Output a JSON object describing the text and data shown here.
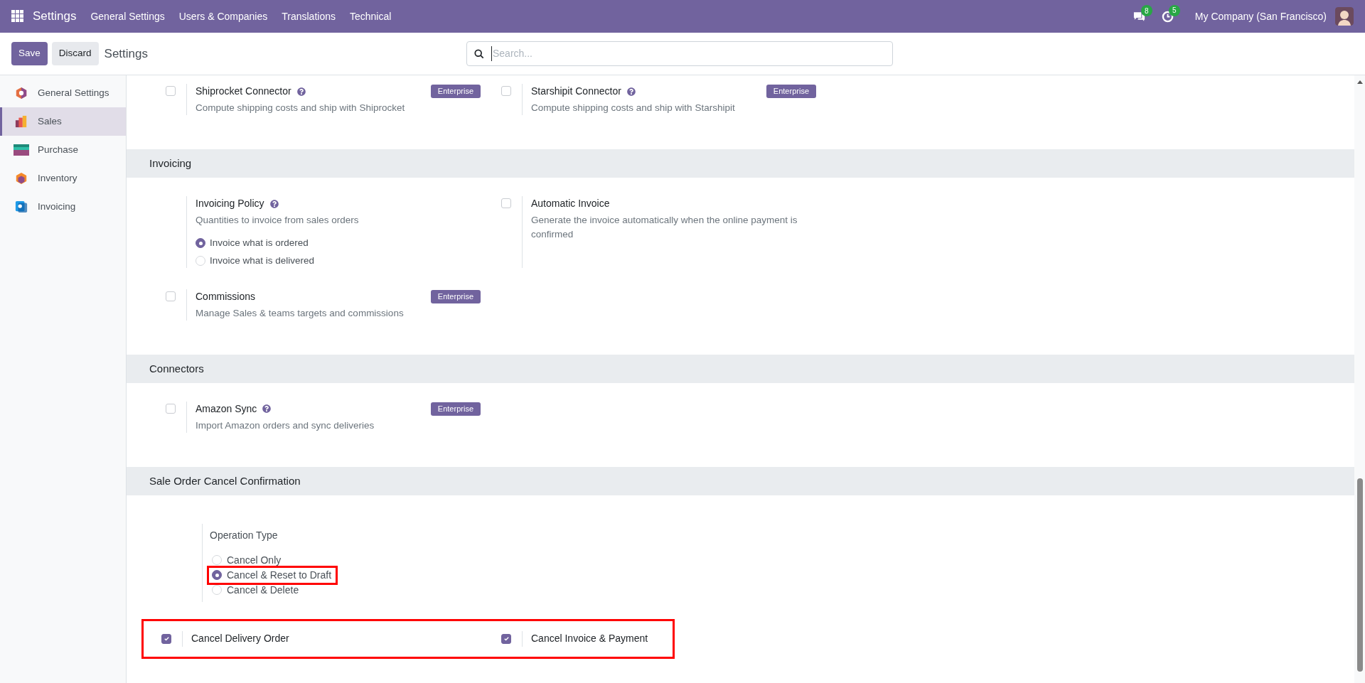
{
  "topbar": {
    "app_title": "Settings",
    "menu": [
      "General Settings",
      "Users & Companies",
      "Translations",
      "Technical"
    ],
    "messages_count": "8",
    "activities_count": "5",
    "company": "My Company (San Francisco)"
  },
  "control_bar": {
    "save": "Save",
    "discard": "Discard",
    "breadcrumb": "Settings",
    "search": {
      "placeholder": "Search..."
    }
  },
  "sidebar": {
    "items": [
      {
        "label": "General Settings",
        "kind": "general",
        "selected": false
      },
      {
        "label": "Sales",
        "kind": "sales",
        "selected": true
      },
      {
        "label": "Purchase",
        "kind": "purchase",
        "selected": false
      },
      {
        "label": "Inventory",
        "kind": "inventory",
        "selected": false
      },
      {
        "label": "Invoicing",
        "kind": "invoicing",
        "selected": false
      }
    ]
  },
  "sections": [
    {
      "settings": [
        {
          "kind": "checkbox",
          "label": "Shiprocket Connector",
          "help": true,
          "badge": "Enterprise",
          "description": "Compute shipping costs and ship with Shiprocket",
          "checked": false
        },
        {
          "kind": "checkbox",
          "label": "Starshipit Connector",
          "help": true,
          "badge": "Enterprise",
          "description": "Compute shipping costs and ship with Starshipit",
          "checked": false
        }
      ]
    },
    {
      "title": "Invoicing",
      "settings": [
        {
          "kind": "radio_setting",
          "label": "Invoicing Policy",
          "help": true,
          "description": "Quantities to invoice from sales orders",
          "options": [
            {
              "label": "Invoice what is ordered",
              "selected": true
            },
            {
              "label": "Invoice what is delivered",
              "selected": false
            }
          ]
        },
        {
          "kind": "checkbox",
          "label": "Automatic Invoice",
          "help": false,
          "description": "Generate the invoice automatically when the online payment is confirmed",
          "checked": false
        },
        {
          "kind": "checkbox",
          "label": "Commissions",
          "help": false,
          "badge": "Enterprise",
          "description": "Manage Sales & teams targets and commissions",
          "checked": false
        }
      ]
    },
    {
      "title": "Connectors",
      "settings": [
        {
          "kind": "checkbox",
          "label": "Amazon Sync",
          "help": true,
          "badge": "Enterprise",
          "description": "Import Amazon orders and sync deliveries",
          "checked": false
        }
      ]
    },
    {
      "title": "Sale Order Cancel Confirmation",
      "settings": [
        {
          "kind": "radio_field",
          "label": "Operation Type",
          "options": [
            {
              "label": "Cancel Only",
              "selected": false,
              "highlighted": false
            },
            {
              "label": "Cancel & Reset to Draft",
              "selected": true,
              "highlighted": true
            },
            {
              "label": "Cancel & Delete",
              "selected": false,
              "highlighted": false
            }
          ]
        },
        {
          "kind": "checkbox_row",
          "highlighted": true,
          "items": [
            {
              "label": "Cancel Delivery Order",
              "checked": true
            },
            {
              "label": "Cancel Invoice & Payment",
              "checked": true
            }
          ]
        }
      ]
    }
  ]
}
